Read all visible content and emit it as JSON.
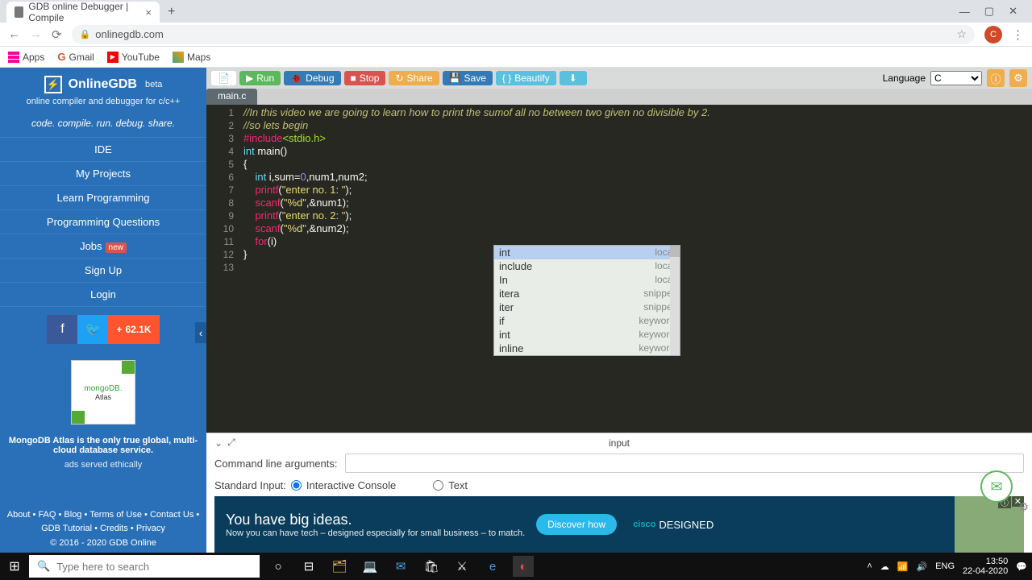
{
  "browser": {
    "tab_title": "GDB online Debugger | Compile",
    "url": "onlinegdb.com",
    "bookmarks": [
      "Apps",
      "Gmail",
      "YouTube",
      "Maps"
    ]
  },
  "sidebar": {
    "name": "OnlineGDB",
    "beta": "beta",
    "tagline": "online compiler and debugger for c/c++",
    "motto": "code. compile. run. debug. share.",
    "nav": [
      "IDE",
      "My Projects",
      "Learn Programming",
      "Programming Questions",
      "Jobs",
      "Sign Up",
      "Login"
    ],
    "jobs_badge": "new",
    "share_count": "62.1K",
    "ad_brand": "mongoDB.",
    "ad_brand_sub": "Atlas",
    "ad_text": "MongoDB Atlas is the only true global, multi-cloud database service.",
    "ad_eth": "ads served ethically",
    "footer": "About • FAQ • Blog • Terms of Use • Contact Us • GDB Tutorial • Credits • Privacy",
    "copyright": "© 2016 - 2020 GDB Online"
  },
  "toolbar": {
    "run": "Run",
    "debug": "Debug",
    "stop": "Stop",
    "share": "Share",
    "save": "Save",
    "beautify": "Beautify",
    "language_label": "Language",
    "language": "C",
    "filetab": "main.c"
  },
  "code": {
    "lines": [
      "//In this video we are going to learn how to print the sumof all no between two given no divisible by 2.",
      "//so lets begin",
      "#include<stdio.h>",
      "int main()",
      "{",
      "    int i,sum=0,num1,num2;",
      "    printf(\"enter no. 1: \");",
      "    scanf(\"%d\",&num1);",
      "    printf(\"enter no. 2: \");",
      "    scanf(\"%d\",&num2);",
      "    for(i)",
      "}",
      ""
    ]
  },
  "autocomplete": [
    {
      "t": "int",
      "k": "local"
    },
    {
      "t": "include",
      "k": "local"
    },
    {
      "t": "In",
      "k": "local"
    },
    {
      "t": "itera",
      "k": "snippet"
    },
    {
      "t": "iter",
      "k": "snippet"
    },
    {
      "t": "if",
      "k": "keyword"
    },
    {
      "t": "int",
      "k": "keyword"
    },
    {
      "t": "inline",
      "k": "keyword"
    }
  ],
  "panel": {
    "input_label": "input",
    "cmd_label": "Command line arguments:",
    "stdin_label": "Standard Input:",
    "opt1": "Interactive Console",
    "opt2": "Text"
  },
  "ad": {
    "headline": "You have big ideas.",
    "sub": "Now you can have tech – designed especially for small business – to match.",
    "cta": "Discover how",
    "brand1": "cisco",
    "brand2": "DESIGNED"
  },
  "taskbar": {
    "search_placeholder": "Type here to search",
    "lang": "ENG",
    "time": "13:50",
    "date": "22-04-2020"
  }
}
